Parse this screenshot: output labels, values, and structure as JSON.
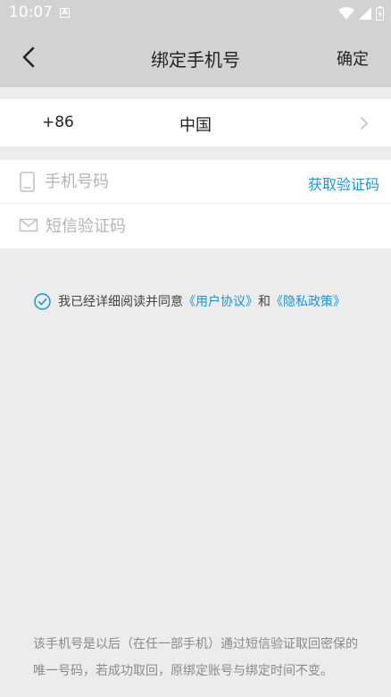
{
  "status_bar": {
    "time": "10:07",
    "notification_badge": "A"
  },
  "nav": {
    "title": "绑定手机号",
    "confirm_label": "确定",
    "back_icon": "chevron-left-icon"
  },
  "country": {
    "code": "+86",
    "name": "中国"
  },
  "form": {
    "phone_placeholder": "手机号码",
    "get_code_label": "获取验证码",
    "code_placeholder": "短信验证码"
  },
  "agreement": {
    "prefix": "我已经详细阅读并同意",
    "user_agreement": "《用户协议》",
    "and": "和",
    "privacy_policy": "《隐私政策》",
    "checked": true
  },
  "footer_note": "该手机号是以后（在任一部手机）通过短信验证取回密保的唯一号码，若成功取回，原绑定账号与绑定时间不变。",
  "colors": {
    "accent": "#1a96d4",
    "header_bg": "#d2d2d2",
    "page_bg": "#ececec"
  }
}
